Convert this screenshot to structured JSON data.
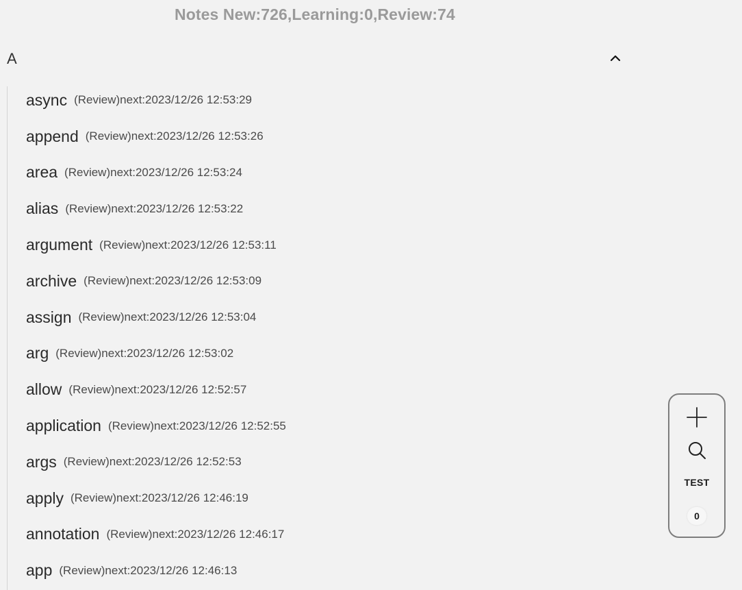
{
  "header": {
    "stats": "Notes New:726,Learning:0,Review:74"
  },
  "group": {
    "letter": "A"
  },
  "words": [
    {
      "word": "async",
      "meta": "(Review)next:2023/12/26 12:53:29"
    },
    {
      "word": "append",
      "meta": "(Review)next:2023/12/26 12:53:26"
    },
    {
      "word": "area",
      "meta": "(Review)next:2023/12/26 12:53:24"
    },
    {
      "word": "alias",
      "meta": "(Review)next:2023/12/26 12:53:22"
    },
    {
      "word": "argument",
      "meta": "(Review)next:2023/12/26 12:53:11"
    },
    {
      "word": "archive",
      "meta": "(Review)next:2023/12/26 12:53:09"
    },
    {
      "word": "assign",
      "meta": "(Review)next:2023/12/26 12:53:04"
    },
    {
      "word": "arg",
      "meta": "(Review)next:2023/12/26 12:53:02"
    },
    {
      "word": "allow",
      "meta": "(Review)next:2023/12/26 12:52:57"
    },
    {
      "word": "application",
      "meta": "(Review)next:2023/12/26 12:52:55"
    },
    {
      "word": "args",
      "meta": "(Review)next:2023/12/26 12:52:53"
    },
    {
      "word": "apply",
      "meta": "(Review)next:2023/12/26 12:46:19"
    },
    {
      "word": "annotation",
      "meta": "(Review)next:2023/12/26 12:46:17"
    },
    {
      "word": "app",
      "meta": "(Review)next:2023/12/26 12:46:13"
    }
  ],
  "fab": {
    "test_label": "TEST",
    "count": "0",
    "add_icon": "plus-icon",
    "search_icon": "search-icon"
  },
  "colors": {
    "background": "#f2f2f2",
    "header_text": "#9a9a9a",
    "panel_border": "#7d7d7d"
  }
}
